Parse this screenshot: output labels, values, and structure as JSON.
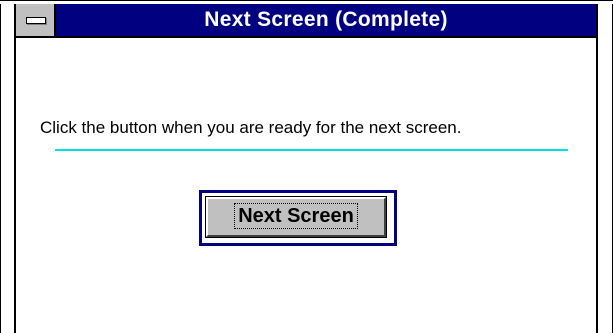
{
  "window": {
    "title": "Next Screen (Complete)"
  },
  "content": {
    "instruction": "Click the button when you are ready for the next screen.",
    "next_button_label": "Next Screen"
  },
  "colors": {
    "titlebar": "#000080",
    "title_text": "#ffffff",
    "divider": "#00e0e0",
    "button_face": "#c0c0c0",
    "focus_border": "#000080"
  },
  "icons": {
    "system_menu": "system-menu-icon"
  }
}
